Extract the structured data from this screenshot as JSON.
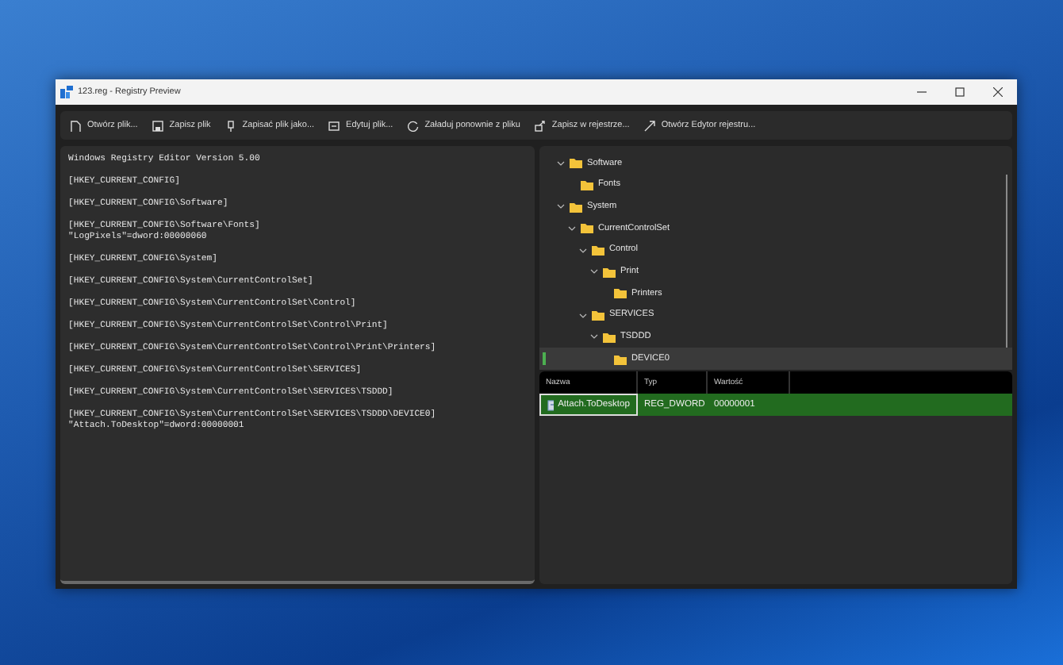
{
  "window": {
    "title": "123.reg - Registry Preview"
  },
  "toolbar": [
    {
      "label": "Otwórz plik..."
    },
    {
      "label": "Zapisz plik"
    },
    {
      "label": "Zapisać plik jako..."
    },
    {
      "label": "Edytuj plik..."
    },
    {
      "label": "Załaduj ponownie z pliku"
    },
    {
      "label": "Zapisz w rejestrze..."
    },
    {
      "label": "Otwórz Edytor rejestru..."
    }
  ],
  "editor": {
    "blocks": [
      [
        "Windows Registry Editor Version 5.00"
      ],
      [
        "[HKEY_CURRENT_CONFIG]"
      ],
      [
        "[HKEY_CURRENT_CONFIG\\Software]"
      ],
      [
        "[HKEY_CURRENT_CONFIG\\Software\\Fonts]",
        "\"LogPixels\"=dword:00000060"
      ],
      [
        "[HKEY_CURRENT_CONFIG\\System]"
      ],
      [
        "[HKEY_CURRENT_CONFIG\\System\\CurrentControlSet]"
      ],
      [
        "[HKEY_CURRENT_CONFIG\\System\\CurrentControlSet\\Control]"
      ],
      [
        "[HKEY_CURRENT_CONFIG\\System\\CurrentControlSet\\Control\\Print]"
      ],
      [
        "[HKEY_CURRENT_CONFIG\\System\\CurrentControlSet\\Control\\Print\\Printers]"
      ],
      [
        "[HKEY_CURRENT_CONFIG\\System\\CurrentControlSet\\SERVICES]"
      ],
      [
        "[HKEY_CURRENT_CONFIG\\System\\CurrentControlSet\\SERVICES\\TSDDD]"
      ],
      [
        "[HKEY_CURRENT_CONFIG\\System\\CurrentControlSet\\SERVICES\\TSDDD\\DEVICE0]",
        "\"Attach.ToDesktop\"=dword:00000001"
      ]
    ]
  },
  "tree": [
    {
      "label": "Software",
      "expanded": true,
      "selected": false,
      "children": [
        {
          "label": "Fonts",
          "selected": false
        }
      ]
    },
    {
      "label": "System",
      "expanded": true,
      "selected": false,
      "children": [
        {
          "label": "CurrentControlSet",
          "expanded": true,
          "selected": false,
          "children": [
            {
              "label": "Control",
              "expanded": true,
              "selected": false,
              "children": [
                {
                  "label": "Print",
                  "expanded": true,
                  "selected": false,
                  "children": [
                    {
                      "label": "Printers",
                      "selected": false
                    }
                  ]
                }
              ]
            },
            {
              "label": "SERVICES",
              "expanded": true,
              "selected": false,
              "children": [
                {
                  "label": "TSDDD",
                  "expanded": true,
                  "selected": false,
                  "children": [
                    {
                      "label": "DEVICE0",
                      "selected": true
                    }
                  ]
                }
              ]
            }
          ]
        }
      ]
    }
  ],
  "table": {
    "columns": [
      "Nazwa",
      "Typ",
      "Wartość"
    ],
    "rows": [
      {
        "selected": true,
        "cells": [
          "Attach.ToDesktop",
          "REG_DWORD",
          "00000001"
        ]
      }
    ]
  }
}
